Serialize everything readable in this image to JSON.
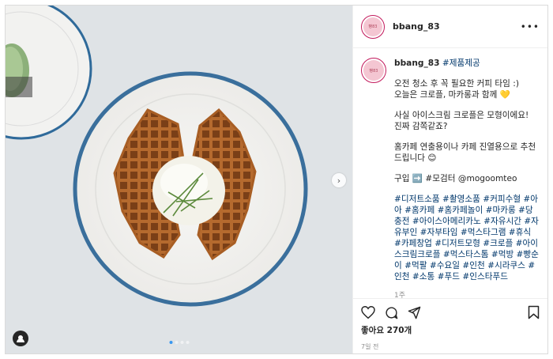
{
  "post": {
    "username": "bbang_83",
    "avatar_text": "빵83",
    "more_icon": "more-dots-icon",
    "caption": {
      "username": "bbang_83",
      "first_tag": "#제품제공",
      "lines_1": [
        "오전 청소 후 꼭 필요한 커피 타임 :)",
        "오늘은 크로플, 마카롱과 함께 💛"
      ],
      "lines_2": [
        "사실 아이스크림 크로플은 모형이에요!",
        "진짜 감쪽같죠?"
      ],
      "lines_3": [
        "홈카페 연출용이나 카페 진열용으로 추천",
        "드립니다 😊"
      ],
      "shop_line": "구입 ➡️ #모검터 @mogoomteo",
      "hashtags": "#디저트소품 #촬영소품 #커피수혈 #아아 #홈카페 #홈카페놀이 #마카롱 #당충전 #아이스아메리카노 #자유시간 #자유부인 #자부타임 #먹스타그램 #휴식 #카페창업 #디저트모형 #크로플 #아이스크림크로플 #먹스타스톰 #먹방 #빵순이 #먹팔 #수요일 #인천 #시라쿠스 #인천 #소통 #푸드 #인스타푸드",
      "time": "1주"
    },
    "likes_text": "좋아요 270개",
    "posted_text": "7일 전",
    "carousel": {
      "count": 4,
      "active": 0
    }
  },
  "colors": {
    "accent_blue": "#3897f0",
    "link": "#00376b",
    "plate_rim": "#3a6f9c"
  },
  "icons": [
    "heart-icon",
    "comment-icon",
    "share-icon",
    "bookmark-icon",
    "next-arrow-icon",
    "user-tag-icon"
  ]
}
